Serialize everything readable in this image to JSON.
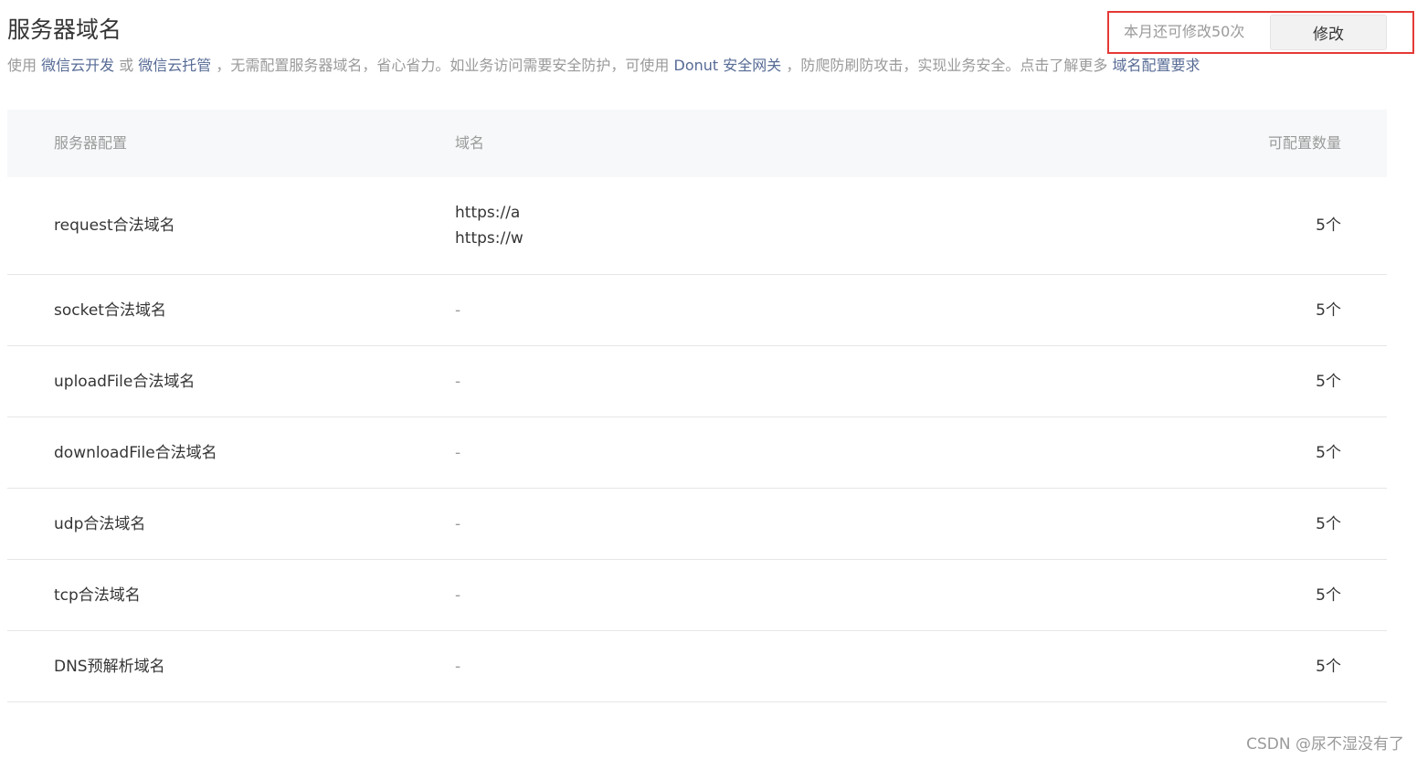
{
  "header": {
    "title": "服务器域名",
    "description": {
      "p1": "使用 ",
      "link1": "微信云开发",
      "p2": " 或 ",
      "link2": "微信云托管",
      "p3": " ，无需配置服务器域名，省心省力。如业务访问需要安全防护，可使用 ",
      "link3": "Donut 安全网关",
      "p4": " ，防爬防刷防攻击，实现业务安全。点击了解更多 ",
      "link4": "域名配置要求"
    },
    "quota_text": "本月还可修改50次",
    "modify_label": "修改"
  },
  "table": {
    "columns": [
      "服务器配置",
      "域名",
      "可配置数量"
    ],
    "rows": [
      {
        "name": "request合法域名",
        "domains": [
          "https://a",
          "https://w"
        ],
        "count": "5个"
      },
      {
        "name": "socket合法域名",
        "domain": "-",
        "count": "5个"
      },
      {
        "name": "uploadFile合法域名",
        "domain": "-",
        "count": "5个"
      },
      {
        "name": "downloadFile合法域名",
        "domain": "-",
        "count": "5个"
      },
      {
        "name": "udp合法域名",
        "domain": "-",
        "count": "5个"
      },
      {
        "name": "tcp合法域名",
        "domain": "-",
        "count": "5个"
      },
      {
        "name": "DNS预解析域名",
        "domain": "-",
        "count": "5个"
      }
    ]
  },
  "watermark": "CSDN @尿不湿没有了",
  "colors": {
    "link": "#576b95",
    "highlight_border": "#e53935",
    "header_bg": "#f6f8f9"
  }
}
